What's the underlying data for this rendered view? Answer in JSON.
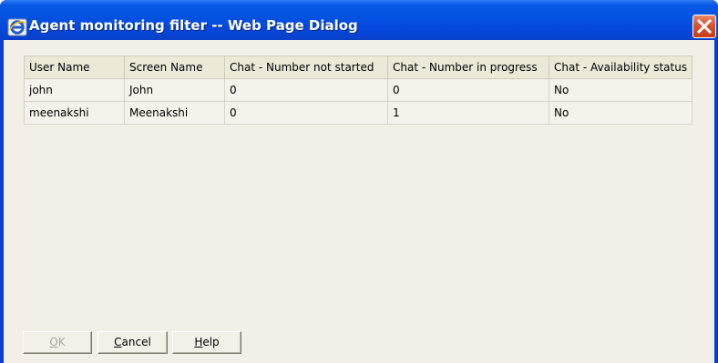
{
  "window": {
    "title": "Agent monitoring filter -- Web Page Dialog",
    "icon": "ie-page-icon",
    "close_icon": "close-icon",
    "colors": {
      "title_bar": "#0451e0",
      "close_button": "#d8542e",
      "client_bg": "#f2f0e6",
      "header_bg": "#ece9d8"
    }
  },
  "table": {
    "headers": [
      "User Name",
      "Screen Name",
      "Chat - Number not started",
      "Chat - Number in progress",
      "Chat - Availability status"
    ],
    "rows": [
      [
        "john",
        "John",
        "0",
        "0",
        "No"
      ],
      [
        "meenakshi",
        "Meenakshi",
        "0",
        "1",
        "No"
      ]
    ]
  },
  "buttons": {
    "ok": {
      "mnemonic": "O",
      "rest": "K",
      "enabled": false
    },
    "cancel": {
      "mnemonic": "C",
      "rest": "ancel",
      "enabled": true
    },
    "help": {
      "mnemonic": "H",
      "rest": "elp",
      "enabled": true
    }
  }
}
